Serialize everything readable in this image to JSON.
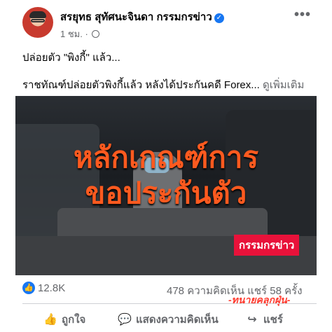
{
  "post": {
    "author": "สรยุทธ สุทัศนะจินดา กรรมกรข่าว",
    "time": "1 ชม. · ",
    "caption_line1": "ปล่อยตัว \"พิงกี้\" แล้ว...",
    "caption_line2": "ราชทัณฑ์ปล่อยตัวพิงกี้แล้ว หลังได้ประกันคดี Forex... ",
    "see_more": "ดูเพิ่มเติม"
  },
  "video": {
    "overlay_line1": "หลักเกณฑ์การ",
    "overlay_line2": "ขอประกันตัว",
    "badge": "กรรมกรข่าว"
  },
  "stats": {
    "likes": "12.8K",
    "comments_shares": "478 ความคิดเห็น   แชร์ 58 ครั้ง"
  },
  "watermark": "-ทนายคลุกฝุ่น-",
  "actions": {
    "like": "ถูกใจ",
    "comment": "แสดงความคิดเห็น",
    "share": "แชร์"
  },
  "icons": {
    "more": "more-options-icon",
    "verified": "verified-badge-icon",
    "globe": "globe-icon",
    "like": "thumbs-up-icon",
    "comment": "comment-icon",
    "share": "share-icon"
  },
  "colors": {
    "accent": "#1877f2",
    "overlay_text": "#ff5a1f",
    "badge_bg": "#e8123a"
  }
}
